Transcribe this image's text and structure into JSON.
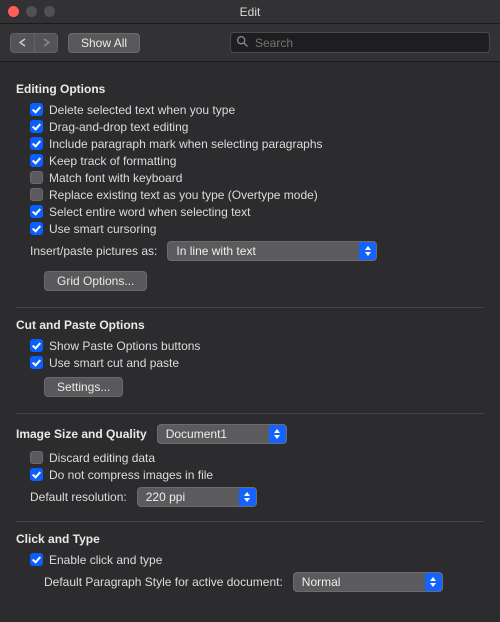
{
  "window": {
    "title": "Edit"
  },
  "toolbar": {
    "show_all": "Show All",
    "search_placeholder": "Search"
  },
  "editing": {
    "title": "Editing Options",
    "opts": [
      {
        "label": "Delete selected text when you type",
        "checked": true
      },
      {
        "label": "Drag-and-drop text editing",
        "checked": true
      },
      {
        "label": "Include paragraph mark when selecting paragraphs",
        "checked": true
      },
      {
        "label": "Keep track of formatting",
        "checked": true
      },
      {
        "label": "Match font with keyboard",
        "checked": false
      },
      {
        "label": "Replace existing text as you type (Overtype mode)",
        "checked": false
      },
      {
        "label": "Select entire word when selecting text",
        "checked": true
      },
      {
        "label": "Use smart cursoring",
        "checked": true
      }
    ],
    "insert_paste_label": "Insert/paste pictures as:",
    "insert_paste_value": "In line with text",
    "grid_options_btn": "Grid Options..."
  },
  "cutpaste": {
    "title": "Cut and Paste Options",
    "opts": [
      {
        "label": "Show Paste Options buttons",
        "checked": true
      },
      {
        "label": "Use smart cut and paste",
        "checked": true
      }
    ],
    "settings_btn": "Settings..."
  },
  "image": {
    "title": "Image Size and Quality",
    "doc_value": "Document1",
    "opts": [
      {
        "label": "Discard editing data",
        "checked": false
      },
      {
        "label": "Do not compress images in file",
        "checked": true
      }
    ],
    "default_res_label": "Default resolution:",
    "default_res_value": "220 ppi"
  },
  "clicktype": {
    "title": "Click and Type",
    "enable": {
      "label": "Enable click and type",
      "checked": true
    },
    "style_label": "Default Paragraph Style for active document:",
    "style_value": "Normal"
  }
}
